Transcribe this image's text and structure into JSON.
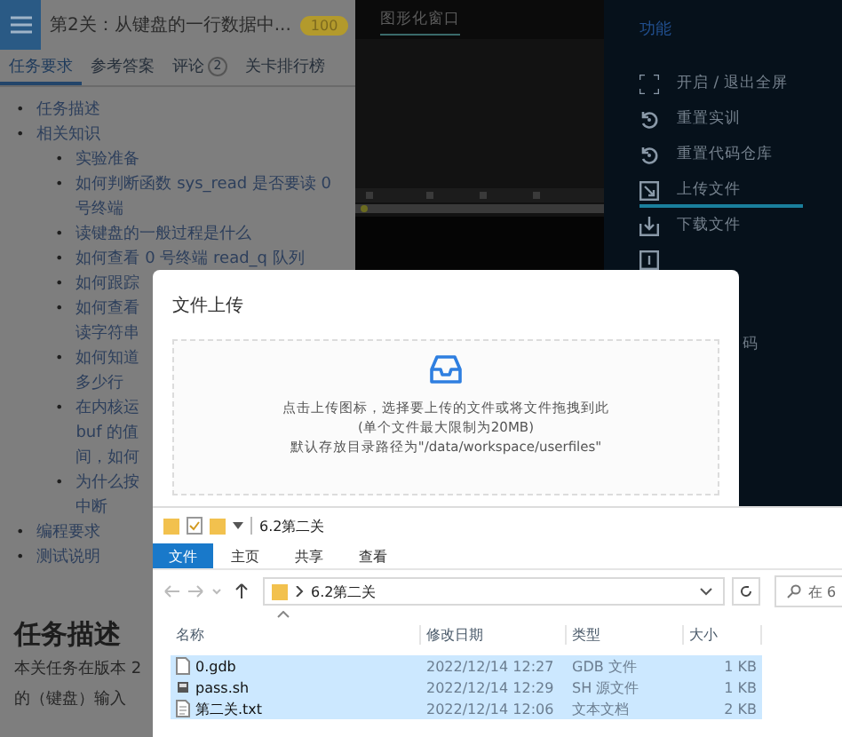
{
  "course_panel": {
    "title": "第2关：从键盘的一行数据中...",
    "badge": "100",
    "tabs": [
      {
        "label": "任务要求",
        "selected": true
      },
      {
        "label": "参考答案",
        "selected": false
      },
      {
        "label": "评论",
        "count": "2",
        "selected": false
      },
      {
        "label": "关卡排行榜",
        "selected": false
      }
    ],
    "outline": [
      {
        "marker": "•",
        "lines": [
          "任务描述"
        ]
      },
      {
        "marker": "•",
        "lines": [
          "相关知识"
        ],
        "children": [
          {
            "marker": "•",
            "lines": [
              "实验准备"
            ]
          },
          {
            "marker": "•",
            "lines": [
              "如何判断函数 sys_read 是否要读 0",
              "号终端"
            ]
          },
          {
            "marker": "•",
            "lines": [
              "读键盘的一般过程是什么"
            ]
          },
          {
            "marker": "•",
            "lines": [
              "如何查看 0 号终端 read_q 队列"
            ]
          },
          {
            "marker": "•",
            "lines": [
              "如何跟踪"
            ]
          },
          {
            "marker": "•",
            "lines": [
              "如何查看",
              "读字符串"
            ]
          },
          {
            "marker": "•",
            "lines": [
              "如何知道",
              "多少行"
            ]
          },
          {
            "marker": "•",
            "lines": [
              "在内核运",
              "buf 的值",
              "间，如何"
            ]
          },
          {
            "marker": "•",
            "lines": [
              "为什么按",
              "中断"
            ]
          }
        ]
      },
      {
        "marker": "•",
        "lines": [
          "编程要求"
        ]
      },
      {
        "marker": "•",
        "lines": [
          "测试说明"
        ]
      }
    ],
    "heading": "任务描述",
    "paragraph_lines": [
      "本关任务在版本 2",
      "的（键盘）输入"
    ]
  },
  "graphics_panel": {
    "tab": "图形化窗口"
  },
  "function_menu": {
    "title": "功能",
    "items": [
      {
        "kind": "fullscreen",
        "label": "开启 / 退出全屏",
        "selected": false
      },
      {
        "kind": "reset",
        "label": "重置实训",
        "selected": false
      },
      {
        "kind": "reset",
        "label": "重置代码仓库",
        "selected": false
      },
      {
        "kind": "upload",
        "label": "上传文件",
        "selected": true
      },
      {
        "kind": "download",
        "label": "下载文件",
        "selected": false
      },
      {
        "kind": "data",
        "selected": false
      }
    ],
    "trailing_text": "码"
  },
  "upload_dialog": {
    "title": "文件上传",
    "hint": "点击上传图标，选择要上传的文件或将文件拖拽到此",
    "limit": "(单个文件最大限制为20MB)",
    "path_note": "默认存放目录路径为\"/data/workspace/userfiles\""
  },
  "explorer": {
    "title": "6.2第二关",
    "ribbon_tabs": [
      {
        "label": "文件",
        "selected": true
      },
      {
        "label": "主页",
        "selected": false
      },
      {
        "label": "共享",
        "selected": false
      },
      {
        "label": "查看",
        "selected": false
      }
    ],
    "address": "6.2第二关",
    "search_placeholder": "在 6",
    "columns": [
      "名称",
      "修改日期",
      "类型",
      "大小"
    ],
    "rows": [
      {
        "kind": "blank",
        "name": "0.gdb",
        "modified": "2022/12/14 12:27",
        "type": "GDB 文件",
        "size": "1 KB",
        "selected": true
      },
      {
        "kind": "script",
        "name": "pass.sh",
        "modified": "2022/12/14 12:29",
        "type": "SH 源文件",
        "size": "1 KB",
        "selected": true
      },
      {
        "kind": "text",
        "name": "第二关.txt",
        "modified": "2022/12/14 12:06",
        "type": "文本文档",
        "size": "2 KB",
        "selected": true
      }
    ]
  }
}
